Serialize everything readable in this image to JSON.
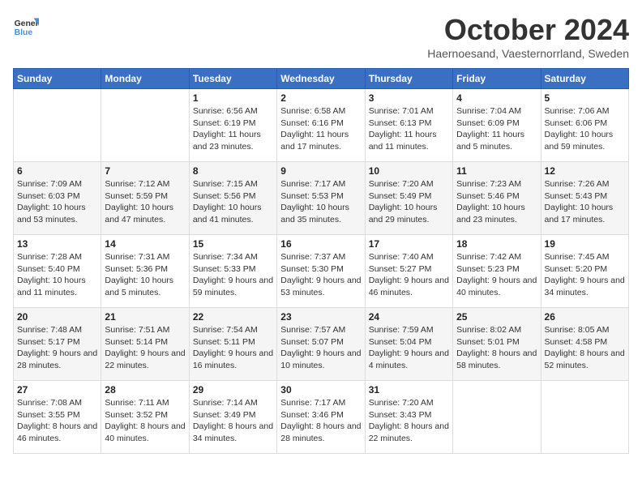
{
  "header": {
    "logo_general": "General",
    "logo_blue": "Blue",
    "month_title": "October 2024",
    "subtitle": "Haernoesand, Vaesternorrland, Sweden"
  },
  "days_of_week": [
    "Sunday",
    "Monday",
    "Tuesday",
    "Wednesday",
    "Thursday",
    "Friday",
    "Saturday"
  ],
  "weeks": [
    [
      {
        "day": "",
        "sunrise": "",
        "sunset": "",
        "daylight": ""
      },
      {
        "day": "",
        "sunrise": "",
        "sunset": "",
        "daylight": ""
      },
      {
        "day": "1",
        "sunrise": "Sunrise: 6:56 AM",
        "sunset": "Sunset: 6:19 PM",
        "daylight": "Daylight: 11 hours and 23 minutes."
      },
      {
        "day": "2",
        "sunrise": "Sunrise: 6:58 AM",
        "sunset": "Sunset: 6:16 PM",
        "daylight": "Daylight: 11 hours and 17 minutes."
      },
      {
        "day": "3",
        "sunrise": "Sunrise: 7:01 AM",
        "sunset": "Sunset: 6:13 PM",
        "daylight": "Daylight: 11 hours and 11 minutes."
      },
      {
        "day": "4",
        "sunrise": "Sunrise: 7:04 AM",
        "sunset": "Sunset: 6:09 PM",
        "daylight": "Daylight: 11 hours and 5 minutes."
      },
      {
        "day": "5",
        "sunrise": "Sunrise: 7:06 AM",
        "sunset": "Sunset: 6:06 PM",
        "daylight": "Daylight: 10 hours and 59 minutes."
      }
    ],
    [
      {
        "day": "6",
        "sunrise": "Sunrise: 7:09 AM",
        "sunset": "Sunset: 6:03 PM",
        "daylight": "Daylight: 10 hours and 53 minutes."
      },
      {
        "day": "7",
        "sunrise": "Sunrise: 7:12 AM",
        "sunset": "Sunset: 5:59 PM",
        "daylight": "Daylight: 10 hours and 47 minutes."
      },
      {
        "day": "8",
        "sunrise": "Sunrise: 7:15 AM",
        "sunset": "Sunset: 5:56 PM",
        "daylight": "Daylight: 10 hours and 41 minutes."
      },
      {
        "day": "9",
        "sunrise": "Sunrise: 7:17 AM",
        "sunset": "Sunset: 5:53 PM",
        "daylight": "Daylight: 10 hours and 35 minutes."
      },
      {
        "day": "10",
        "sunrise": "Sunrise: 7:20 AM",
        "sunset": "Sunset: 5:49 PM",
        "daylight": "Daylight: 10 hours and 29 minutes."
      },
      {
        "day": "11",
        "sunrise": "Sunrise: 7:23 AM",
        "sunset": "Sunset: 5:46 PM",
        "daylight": "Daylight: 10 hours and 23 minutes."
      },
      {
        "day": "12",
        "sunrise": "Sunrise: 7:26 AM",
        "sunset": "Sunset: 5:43 PM",
        "daylight": "Daylight: 10 hours and 17 minutes."
      }
    ],
    [
      {
        "day": "13",
        "sunrise": "Sunrise: 7:28 AM",
        "sunset": "Sunset: 5:40 PM",
        "daylight": "Daylight: 10 hours and 11 minutes."
      },
      {
        "day": "14",
        "sunrise": "Sunrise: 7:31 AM",
        "sunset": "Sunset: 5:36 PM",
        "daylight": "Daylight: 10 hours and 5 minutes."
      },
      {
        "day": "15",
        "sunrise": "Sunrise: 7:34 AM",
        "sunset": "Sunset: 5:33 PM",
        "daylight": "Daylight: 9 hours and 59 minutes."
      },
      {
        "day": "16",
        "sunrise": "Sunrise: 7:37 AM",
        "sunset": "Sunset: 5:30 PM",
        "daylight": "Daylight: 9 hours and 53 minutes."
      },
      {
        "day": "17",
        "sunrise": "Sunrise: 7:40 AM",
        "sunset": "Sunset: 5:27 PM",
        "daylight": "Daylight: 9 hours and 46 minutes."
      },
      {
        "day": "18",
        "sunrise": "Sunrise: 7:42 AM",
        "sunset": "Sunset: 5:23 PM",
        "daylight": "Daylight: 9 hours and 40 minutes."
      },
      {
        "day": "19",
        "sunrise": "Sunrise: 7:45 AM",
        "sunset": "Sunset: 5:20 PM",
        "daylight": "Daylight: 9 hours and 34 minutes."
      }
    ],
    [
      {
        "day": "20",
        "sunrise": "Sunrise: 7:48 AM",
        "sunset": "Sunset: 5:17 PM",
        "daylight": "Daylight: 9 hours and 28 minutes."
      },
      {
        "day": "21",
        "sunrise": "Sunrise: 7:51 AM",
        "sunset": "Sunset: 5:14 PM",
        "daylight": "Daylight: 9 hours and 22 minutes."
      },
      {
        "day": "22",
        "sunrise": "Sunrise: 7:54 AM",
        "sunset": "Sunset: 5:11 PM",
        "daylight": "Daylight: 9 hours and 16 minutes."
      },
      {
        "day": "23",
        "sunrise": "Sunrise: 7:57 AM",
        "sunset": "Sunset: 5:07 PM",
        "daylight": "Daylight: 9 hours and 10 minutes."
      },
      {
        "day": "24",
        "sunrise": "Sunrise: 7:59 AM",
        "sunset": "Sunset: 5:04 PM",
        "daylight": "Daylight: 9 hours and 4 minutes."
      },
      {
        "day": "25",
        "sunrise": "Sunrise: 8:02 AM",
        "sunset": "Sunset: 5:01 PM",
        "daylight": "Daylight: 8 hours and 58 minutes."
      },
      {
        "day": "26",
        "sunrise": "Sunrise: 8:05 AM",
        "sunset": "Sunset: 4:58 PM",
        "daylight": "Daylight: 8 hours and 52 minutes."
      }
    ],
    [
      {
        "day": "27",
        "sunrise": "Sunrise: 7:08 AM",
        "sunset": "Sunset: 3:55 PM",
        "daylight": "Daylight: 8 hours and 46 minutes."
      },
      {
        "day": "28",
        "sunrise": "Sunrise: 7:11 AM",
        "sunset": "Sunset: 3:52 PM",
        "daylight": "Daylight: 8 hours and 40 minutes."
      },
      {
        "day": "29",
        "sunrise": "Sunrise: 7:14 AM",
        "sunset": "Sunset: 3:49 PM",
        "daylight": "Daylight: 8 hours and 34 minutes."
      },
      {
        "day": "30",
        "sunrise": "Sunrise: 7:17 AM",
        "sunset": "Sunset: 3:46 PM",
        "daylight": "Daylight: 8 hours and 28 minutes."
      },
      {
        "day": "31",
        "sunrise": "Sunrise: 7:20 AM",
        "sunset": "Sunset: 3:43 PM",
        "daylight": "Daylight: 8 hours and 22 minutes."
      },
      {
        "day": "",
        "sunrise": "",
        "sunset": "",
        "daylight": ""
      },
      {
        "day": "",
        "sunrise": "",
        "sunset": "",
        "daylight": ""
      }
    ]
  ]
}
